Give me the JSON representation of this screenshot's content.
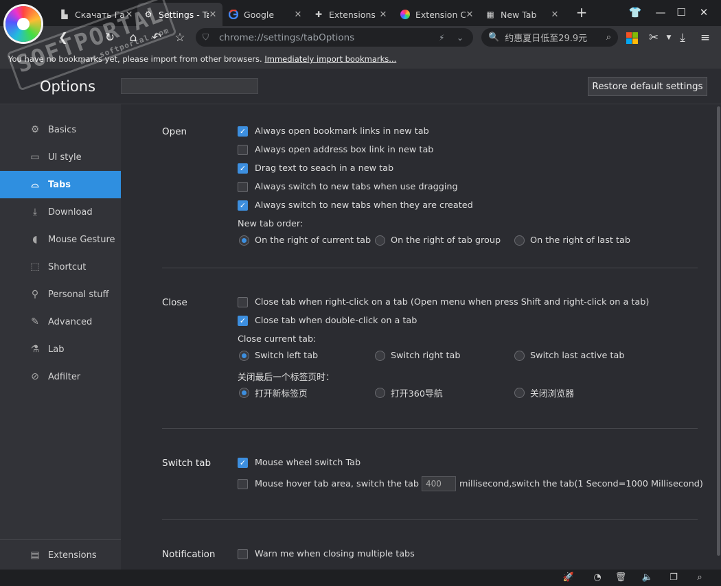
{
  "tabs": [
    {
      "label": "Скачать Гам",
      "icon": "page-icon",
      "active": false
    },
    {
      "label": "Settings - Tab",
      "icon": "gear-icon",
      "active": true
    },
    {
      "label": "Google",
      "icon": "google-icon",
      "active": false
    },
    {
      "label": "Extensions In",
      "icon": "extensions-icon",
      "active": false
    },
    {
      "label": "Extension Ce",
      "icon": "browser-logo-icon",
      "active": false
    },
    {
      "label": "New Tab",
      "icon": "grid-icon",
      "active": false
    }
  ],
  "omnibox": {
    "url": "chrome://settings/tabOptions"
  },
  "searchbox": {
    "text": "约惠夏日低至29.9元"
  },
  "bookmarkbar": {
    "message": "You have no bookmarks yet, please import from other browsers.",
    "link": "Immediately import bookmarks..."
  },
  "watermark": {
    "text": "SOFTPORTAL",
    "url": "www.softportal.com"
  },
  "header": {
    "title": "Options",
    "search_placeholder": "",
    "restore_label": "Restore default settings"
  },
  "sidebar": {
    "items": [
      {
        "label": "Basics",
        "icon": "gear-icon"
      },
      {
        "label": "UI style",
        "icon": "window-icon"
      },
      {
        "label": "Tabs",
        "icon": "tab-icon",
        "active": true
      },
      {
        "label": "Download",
        "icon": "download-icon"
      },
      {
        "label": "Mouse Gesture",
        "icon": "mouse-icon"
      },
      {
        "label": "Shortcut",
        "icon": "shortcut-icon"
      },
      {
        "label": "Personal stuff",
        "icon": "person-icon"
      },
      {
        "label": "Advanced",
        "icon": "wrench-icon"
      },
      {
        "label": "Lab",
        "icon": "flask-icon"
      },
      {
        "label": "Adfilter",
        "icon": "block-icon"
      }
    ],
    "extensions_label": "Extensions"
  },
  "open": {
    "label": "Open",
    "checks": [
      {
        "label": "Always open bookmark links in new tab",
        "checked": true
      },
      {
        "label": "Always open address box link in new tab",
        "checked": false
      },
      {
        "label": "Drag text to seach in a new tab",
        "checked": true
      },
      {
        "label": "Always switch to new tabs when use dragging",
        "checked": false
      },
      {
        "label": "Always switch to new tabs when they are created",
        "checked": true
      }
    ],
    "order_label": "New tab order:",
    "order_options": [
      {
        "label": "On the right of current tab",
        "selected": true
      },
      {
        "label": "On the right of tab group",
        "selected": false
      },
      {
        "label": "On the right of last tab",
        "selected": false
      }
    ]
  },
  "close": {
    "label": "Close",
    "checks": [
      {
        "label": "Close tab when right-click on a tab (Open menu when press Shift and right-click on a tab)",
        "checked": false
      },
      {
        "label": "Close tab when double-click on a tab",
        "checked": true
      }
    ],
    "current_label": "Close current tab:",
    "current_options": [
      {
        "label": "Switch left tab",
        "selected": true
      },
      {
        "label": "Switch right tab",
        "selected": false
      },
      {
        "label": "Switch last active tab",
        "selected": false
      }
    ],
    "last_label": "关闭最后一个标签页时：",
    "last_options": [
      {
        "label": "打开新标签页",
        "selected": true
      },
      {
        "label": "打开360导航",
        "selected": false
      },
      {
        "label": "关闭浏览器",
        "selected": false
      }
    ]
  },
  "switch": {
    "label": "Switch tab",
    "wheel": {
      "label": "Mouse wheel switch Tab",
      "checked": true
    },
    "hover": {
      "label": "Mouse hover tab area, switch the tab",
      "checked": false,
      "value": "400",
      "suffix": "millisecond,switch the tab(1 Second=1000 Millisecond)"
    }
  },
  "notification": {
    "label": "Notification",
    "warn": {
      "label": "Warn me when closing multiple tabs",
      "checked": false
    }
  },
  "colors": {
    "accent": "#2f8fe0",
    "background": "#2b2c31",
    "sidebar": "#323338"
  }
}
